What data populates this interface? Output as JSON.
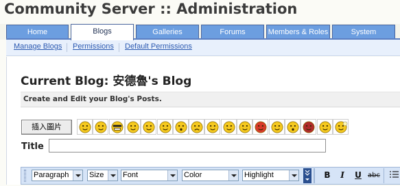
{
  "app": {
    "title": "Community Server :: Administration"
  },
  "tabs": [
    {
      "label": "Home",
      "active": false
    },
    {
      "label": "Blogs",
      "active": true
    },
    {
      "label": "Galleries",
      "active": false
    },
    {
      "label": "Forums",
      "active": false
    },
    {
      "label": "Members & Roles",
      "active": false
    },
    {
      "label": "System",
      "active": false
    }
  ],
  "subnav": [
    "Manage Blogs",
    "Permissions",
    "Default Permissions"
  ],
  "page": {
    "heading": "Current Blog: 安德魯's Blog",
    "description": "Create and Edit your Blog's Posts."
  },
  "toolbar": {
    "insert_image_label": "插入圖片",
    "smileys": [
      "grin-smiley-icon",
      "teeth-smiley-icon",
      "glasses-smiley-icon",
      "wink-smiley-icon",
      "confused-smiley-icon",
      "sick-smiley-icon",
      "surprised-smiley-icon",
      "sad-smiley-icon",
      "thinking-smiley-icon",
      "blush-smiley-icon",
      "smile-smiley-icon",
      "angry-smiley-icon",
      "neutral-smiley-icon",
      "sleepy-smiley-icon",
      "devil-smiley-icon",
      "reading-smiley-icon",
      "idea-smiley-icon"
    ]
  },
  "form": {
    "title_label": "Title",
    "title_value": ""
  },
  "editor": {
    "paragraph": "Paragraph",
    "size": "Size",
    "font": "Font",
    "color": "Color",
    "highlight": "Highlight",
    "bold": "B",
    "italic": "I",
    "underline": "U",
    "strike": "abc"
  },
  "colors": {
    "tab_blue": "#6c9ee0",
    "accent_navy": "#2a4f8f",
    "link": "#2a58b0"
  }
}
